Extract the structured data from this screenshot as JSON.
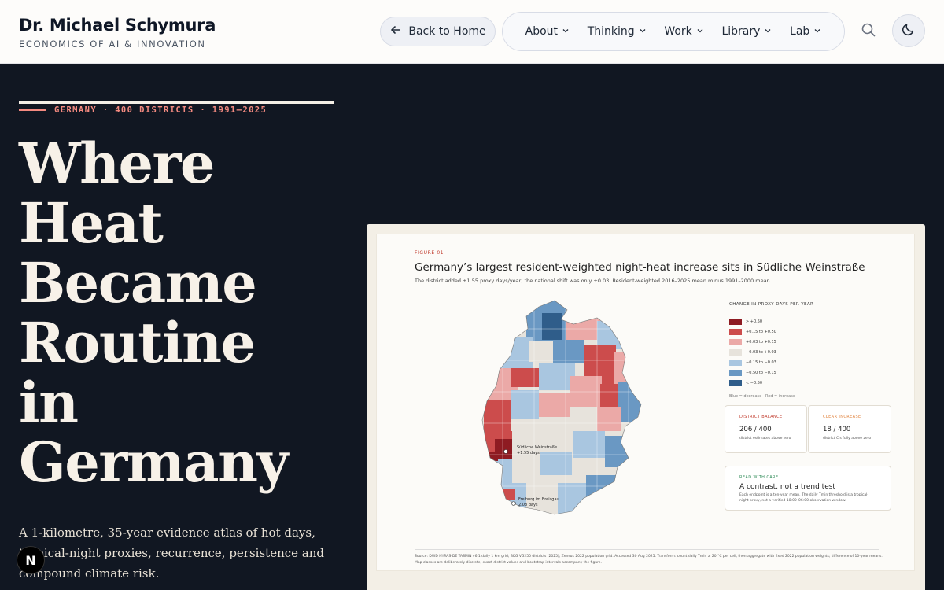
{
  "header": {
    "name": "Dr. Michael Schymura",
    "tagline": "ECONOMICS OF AI & INNOVATION",
    "back_label": "Back to Home",
    "nav": [
      {
        "label": "About"
      },
      {
        "label": "Thinking"
      },
      {
        "label": "Work"
      },
      {
        "label": "Library"
      },
      {
        "label": "Lab"
      }
    ],
    "icons": {
      "search": "search-icon",
      "theme": "moon-icon",
      "back": "arrow-left-icon"
    }
  },
  "hero": {
    "kicker": "GERMANY · 400 DISTRICTS · 1991–2025",
    "title_lines": [
      "Where",
      "Heat",
      "Became",
      "Routine",
      "in",
      "Germany"
    ],
    "subtitle": "A 1-kilometre, 35-year evidence atlas of hot days, tropical-night proxies, recurrence, persistence and compound climate risk."
  },
  "badge": {
    "label": "N"
  },
  "figure": {
    "label": "FIGURE 01",
    "title": "Germany’s largest resident-weighted night-heat increase sits in Südliche Weinstraße",
    "subtitle": "The district added +1.55 proxy days/year; the national shift was only +0.03. Resident-weighted 2016–2025 mean minus 1991–2000 mean.",
    "legend_title": "CHANGE IN PROXY DAYS PER YEAR",
    "legend": [
      {
        "label": "> +0.50",
        "color": "#8e1b22"
      },
      {
        "label": "+0.15 to +0.50",
        "color": "#cc4c4c"
      },
      {
        "label": "+0.03 to +0.15",
        "color": "#eba9a7"
      },
      {
        "label": "−0.03 to +0.03",
        "color": "#e7e3dc"
      },
      {
        "label": "−0.15 to −0.03",
        "color": "#a9c6e0"
      },
      {
        "label": "−0.50 to −0.15",
        "color": "#6a98c3"
      },
      {
        "label": "< −0.50",
        "color": "#2f5d8a"
      }
    ],
    "legend_note": "Blue = decrease · Red = increase",
    "map_labels": {
      "top": "Südliche Weinstraße",
      "top_value": "+1.55 days",
      "bottom": "Freiburg im Breisgau",
      "bottom_value": "2.08 days"
    },
    "cards": {
      "balance_label": "DISTRICT BALANCE",
      "balance_value": "206 / 400",
      "balance_note": "district estimates above zero",
      "clear_label": "CLEAR INCREASE",
      "clear_value": "18 / 400",
      "clear_note": "district CIs fully above zero",
      "care_label": "READ WITH CARE",
      "care_title": "A contrast, not a trend test",
      "care_note": "Each endpoint is a ten-year mean. The daily Tmin threshold is a tropical-night proxy, not a verified 18:00–06:00 observation window."
    },
    "source": "Source: DWD HYRAS-DE TASMIN v6.1 daily 1 km grid; BKG VG250 districts (2025); Zensus 2022 population grid. Accessed 30 Aug 2025. Transform: count daily Tmin ≥ 20 °C per cell, then aggregate with fixed 2022 population weights; difference of 10-year means. Map classes are deliberately discrete; exact district values and bootstrap intervals accompany the figure."
  },
  "colors": {
    "header_bg": "#fdfcfa",
    "hero_bg": "#111722",
    "accent": "#f48a80",
    "title": "#f7f1e8"
  }
}
